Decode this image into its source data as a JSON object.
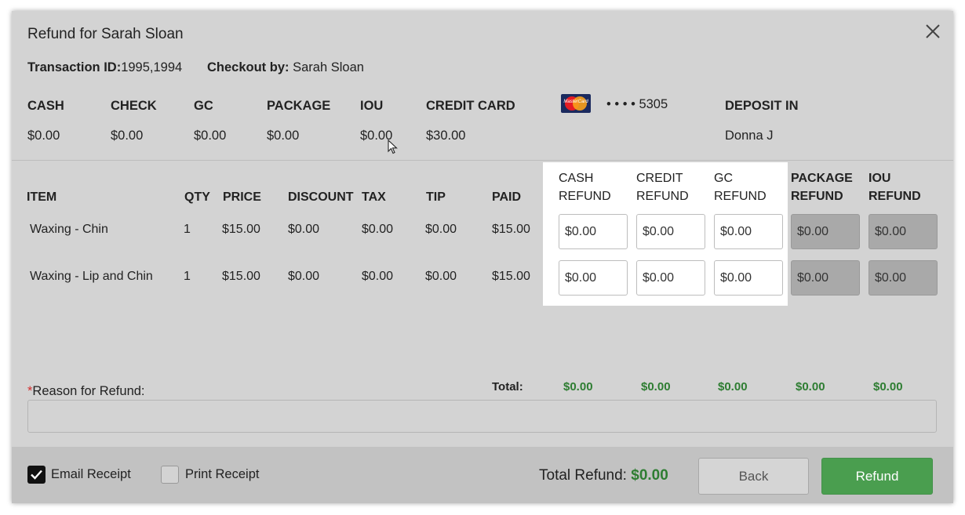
{
  "dialog": {
    "title": "Refund for Sarah Sloan"
  },
  "meta": {
    "transaction_label": "Transaction ID:",
    "transaction_value": "1995,1994",
    "checkout_label": "Checkout by:",
    "checkout_value": "Sarah Sloan"
  },
  "payments": [
    {
      "label": "CASH",
      "value": "$0.00"
    },
    {
      "label": "CHECK",
      "value": "$0.00"
    },
    {
      "label": "GC",
      "value": "$0.00"
    },
    {
      "label": "PACKAGE",
      "value": "$0.00"
    },
    {
      "label": "IOU",
      "value": "$0.00"
    },
    {
      "label": "CREDIT CARD",
      "value": "$30.00"
    }
  ],
  "card": {
    "brand_text": "MasterCard",
    "number": "• • • •  5305"
  },
  "deposit": {
    "label": "DEPOSIT IN",
    "value": "Donna J"
  },
  "table": {
    "headers": {
      "item": "ITEM",
      "qty": "QTY",
      "price": "PRICE",
      "discount": "DISCOUNT",
      "tax": "TAX",
      "tip": "TIP",
      "paid": "PAID",
      "cash_refund_1": "CASH",
      "cash_refund_2": "REFUND",
      "credit_refund_1": "CREDIT",
      "credit_refund_2": "REFUND",
      "gc_refund_1": "GC",
      "gc_refund_2": "REFUND",
      "package_refund_1": "PACKAGE",
      "package_refund_2": "REFUND",
      "iou_refund_1": "IOU",
      "iou_refund_2": "REFUND"
    },
    "rows": [
      {
        "item": "Waxing - Chin",
        "qty": "1",
        "price": "$15.00",
        "discount": "$0.00",
        "tax": "$0.00",
        "tip": "$0.00",
        "paid": "$15.00",
        "cash_refund": "$0.00",
        "credit_refund": "$0.00",
        "gc_refund": "$0.00",
        "package_refund": "$0.00",
        "iou_refund": "$0.00"
      },
      {
        "item": "Waxing - Lip and Chin",
        "qty": "1",
        "price": "$15.00",
        "discount": "$0.00",
        "tax": "$0.00",
        "tip": "$0.00",
        "paid": "$15.00",
        "cash_refund": "$0.00",
        "credit_refund": "$0.00",
        "gc_refund": "$0.00",
        "package_refund": "$0.00",
        "iou_refund": "$0.00"
      }
    ],
    "totals": {
      "label": "Total:",
      "cash": "$0.00",
      "credit": "$0.00",
      "gc": "$0.00",
      "package": "$0.00",
      "iou": "$0.00"
    }
  },
  "reason": {
    "required_mark": "*",
    "label": "Reason for Refund:",
    "value": ""
  },
  "footer": {
    "email_receipt": "Email Receipt",
    "email_checked": true,
    "print_receipt": "Print Receipt",
    "print_checked": false,
    "total_refund_label": "Total Refund:",
    "total_refund_value": "$0.00",
    "back_label": "Back",
    "refund_label": "Refund"
  },
  "colors": {
    "accent_green": "#4a9e4f",
    "total_green": "#2e7d32",
    "dialog_bg": "#d3d3d3"
  }
}
